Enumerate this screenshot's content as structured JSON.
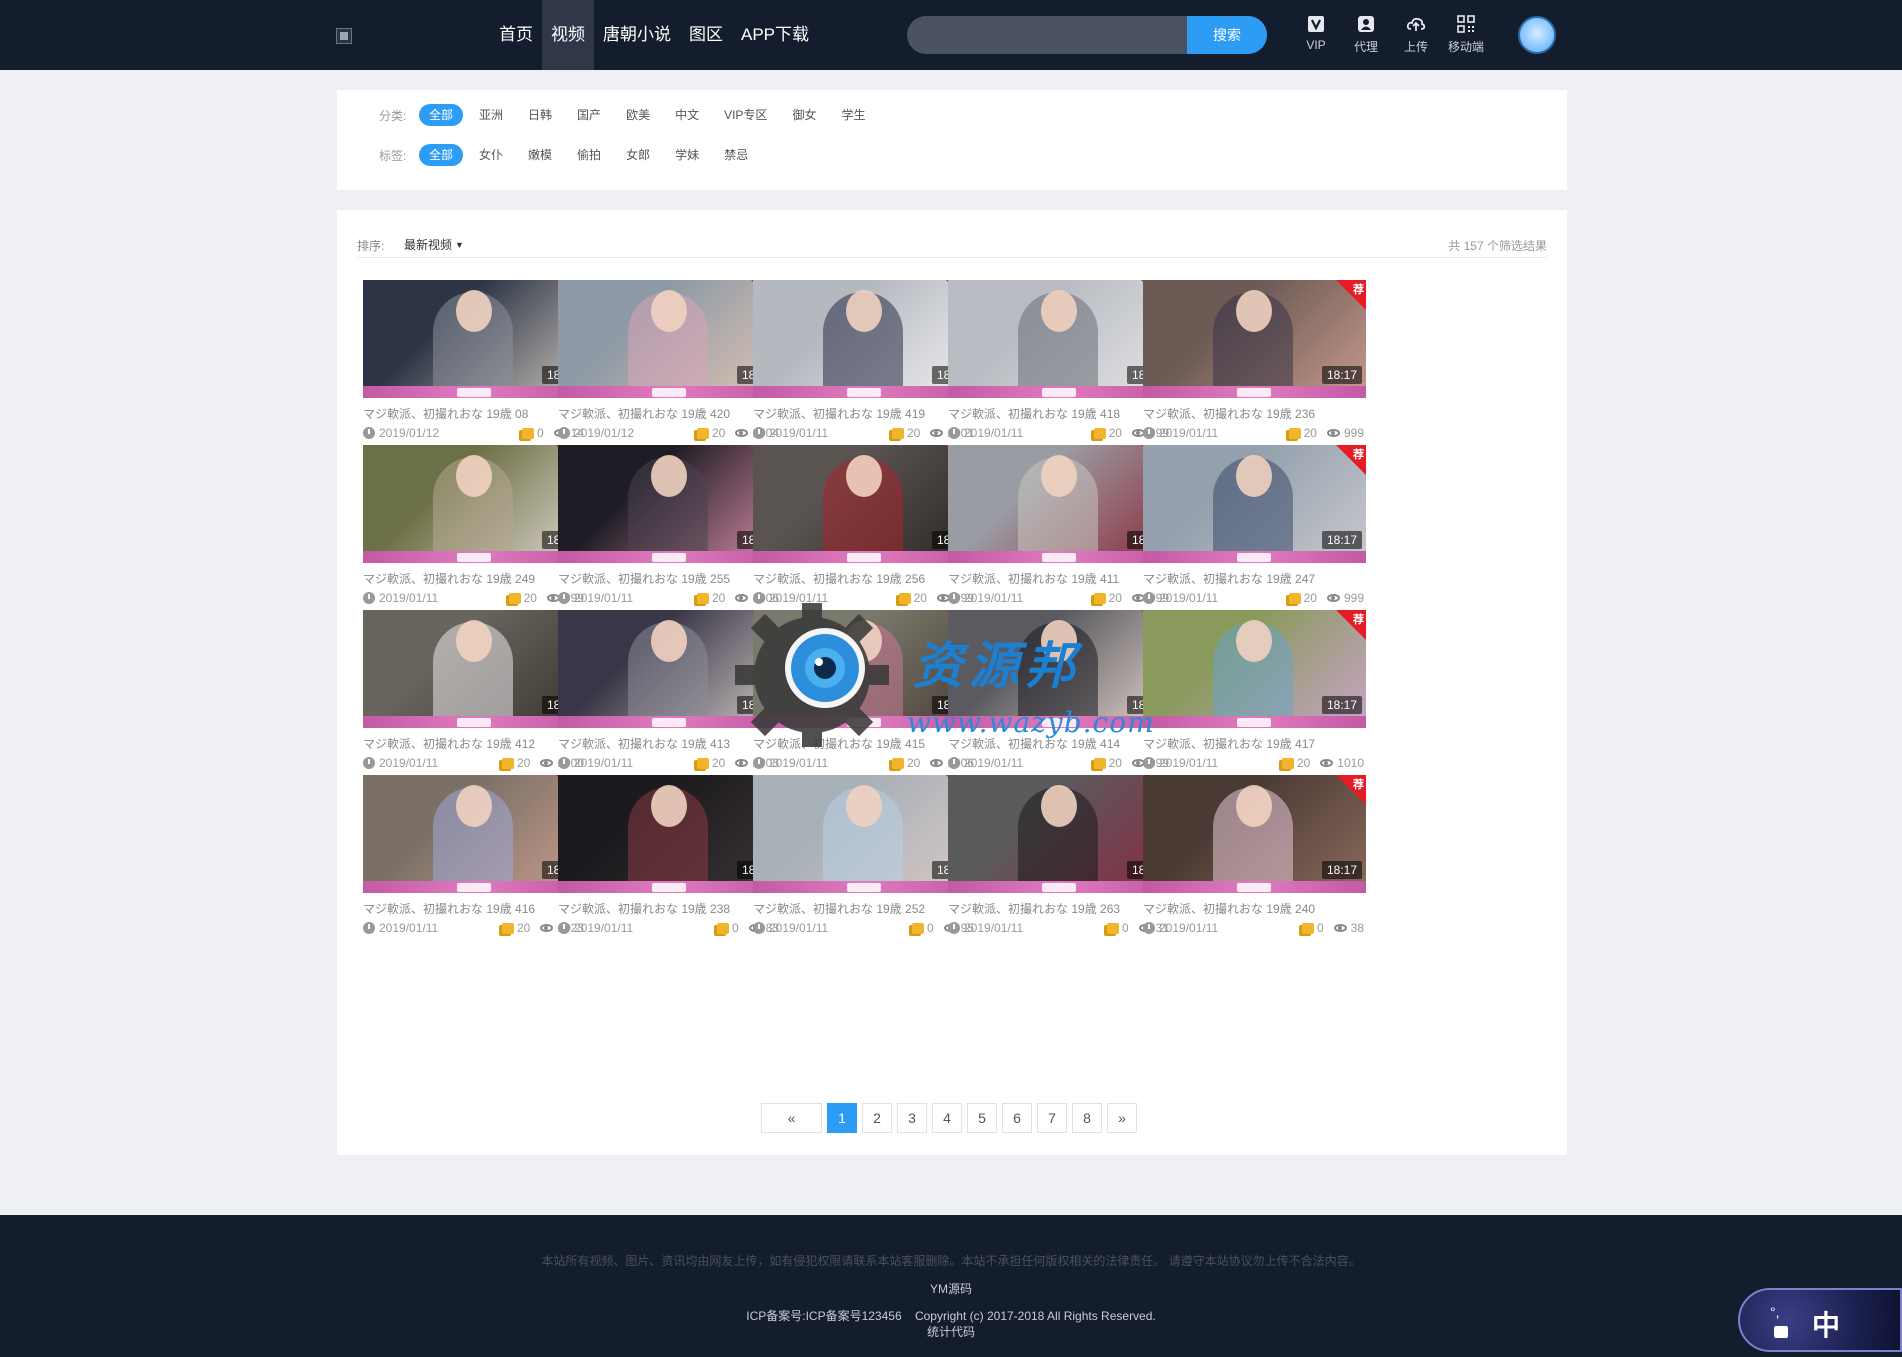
{
  "header": {
    "nav": [
      "首页",
      "视频",
      "唐朝小说",
      "图区",
      "APP下载"
    ],
    "active_nav": 1,
    "search_placeholder": "",
    "search_button": "搜索",
    "tools": [
      {
        "label": "VIP",
        "icon": "vip-icon"
      },
      {
        "label": "代理",
        "icon": "agent-icon"
      },
      {
        "label": "上传",
        "icon": "upload-cloud-icon"
      },
      {
        "label": "移动端",
        "icon": "qrcode-icon"
      }
    ]
  },
  "filters": {
    "category_label": "分类:",
    "categories": [
      "全部",
      "亚洲",
      "日韩",
      "国产",
      "欧美",
      "中文",
      "VIP专区",
      "御女",
      "学生"
    ],
    "tag_label": "标签:",
    "tags": [
      "全部",
      "女仆",
      "嫩模",
      "偷拍",
      "女郎",
      "学妹",
      "禁忌"
    ]
  },
  "sort": {
    "label": "排序:",
    "value": "最新视频",
    "result_text": "共 157 个筛选结果"
  },
  "badge_text": "荐",
  "videos": [
    {
      "title": "マジ軟派、初撮れおな 19歳 08",
      "date": "2019/01/12",
      "coins": "0",
      "views": "14",
      "duration": "18:17",
      "colors": [
        "#2c3446",
        "#8d8f9a",
        "#c8c0b8"
      ]
    },
    {
      "title": "マジ軟派、初撮れおな 19歳 420",
      "date": "2019/01/12",
      "coins": "20",
      "views": "1004",
      "duration": "18:17",
      "colors": [
        "#8e9aa6",
        "#d8a4b8",
        "#e0c4b4"
      ]
    },
    {
      "title": "マジ軟派、初撮れおな 19歳 419",
      "date": "2019/01/11",
      "coins": "20",
      "views": "1001",
      "duration": "18:17",
      "colors": [
        "#b4b8bf",
        "#2a2e48",
        "#f0f0f0"
      ]
    },
    {
      "title": "マジ軟派、初撮れおな 19歳 418",
      "date": "2019/01/11",
      "coins": "20",
      "views": "999",
      "duration": "18:17",
      "colors": [
        "#b8bcc2",
        "#6a6e78",
        "#e4e4e4"
      ]
    },
    {
      "title": "マジ軟派、初撮れおな 19歳 236",
      "date": "2019/01/11",
      "coins": "20",
      "views": "999",
      "duration": "18:17",
      "colors": [
        "#6c5a54",
        "#3a3448",
        "#c79a8c"
      ]
    },
    {
      "title": "マジ軟派、初撮れおな 19歳 249",
      "date": "2019/01/11",
      "coins": "20",
      "views": "999",
      "duration": "18:17",
      "colors": [
        "#6c7046",
        "#b4a890",
        "#e0d8d0"
      ]
    },
    {
      "title": "マジ軟派、初撮れおな 19歳 255",
      "date": "2019/01/11",
      "coins": "20",
      "views": "1006",
      "duration": "18:17",
      "colors": [
        "#1e1c24",
        "#4a444e",
        "#d88ca8"
      ]
    },
    {
      "title": "マジ軟派、初撮れおな 19歳 256",
      "date": "2019/01/11",
      "coins": "20",
      "views": "999",
      "duration": "18:17",
      "colors": [
        "#5a5450",
        "#a8242c",
        "#2a2424"
      ]
    },
    {
      "title": "マジ軟派、初撮れおな 19歳 411",
      "date": "2019/01/11",
      "coins": "20",
      "views": "999",
      "duration": "18:17",
      "colors": [
        "#9a9ca4",
        "#c8c4c0",
        "#8c2a38"
      ]
    },
    {
      "title": "マジ軟派、初撮れおな 19歳 247",
      "date": "2019/01/11",
      "coins": "20",
      "views": "999",
      "duration": "18:17",
      "colors": [
        "#94a0ae",
        "#3a4a6a",
        "#c8c8cc"
      ]
    },
    {
      "title": "マジ軟派、初撮れおな 19歳 412",
      "date": "2019/01/11",
      "coins": "20",
      "views": "1000",
      "duration": "18:17",
      "colors": [
        "#6a645e",
        "#e8e8ea",
        "#3a3430"
      ]
    },
    {
      "title": "マジ軟派、初撮れおな 19歳 413",
      "date": "2019/01/11",
      "coins": "20",
      "views": "1003",
      "duration": "18:17",
      "colors": [
        "#3a3648",
        "#8a8c98",
        "#d0c8c4"
      ]
    },
    {
      "title": "マジ軟派、初撮れおな 19歳 415",
      "date": "2019/01/11",
      "coins": "20",
      "views": "1006",
      "duration": "18:17",
      "colors": [
        "#7a7a6c",
        "#c87898",
        "#4a3e38"
      ]
    },
    {
      "title": "マジ軟派、初撮れおな 19歳 414",
      "date": "2019/01/11",
      "coins": "20",
      "views": "999",
      "duration": "18:17",
      "colors": [
        "#5a5a60",
        "#1c1c22",
        "#e4d4cc"
      ]
    },
    {
      "title": "マジ軟派、初撮れおな 19歳 417",
      "date": "2019/01/11",
      "coins": "20",
      "views": "1010",
      "duration": "18:17",
      "colors": [
        "#8a9a5c",
        "#6aa4c8",
        "#c8a4c8"
      ]
    },
    {
      "title": "マジ軟派、初撮れおな 19歳 416",
      "date": "2019/01/11",
      "coins": "20",
      "views": "1023",
      "duration": "18:17",
      "colors": [
        "#7a7066",
        "#a0a8d8",
        "#c89c8c"
      ]
    },
    {
      "title": "マジ軟派、初撮れおな 19歳 238",
      "date": "2019/01/11",
      "coins": "0",
      "views": "83",
      "duration": "18:17",
      "colors": [
        "#1c1a1e",
        "#8a3a44",
        "#3a3436"
      ]
    },
    {
      "title": "マジ軟派、初撮れおな 19歳 252",
      "date": "2019/01/11",
      "coins": "0",
      "views": "95",
      "duration": "18:17",
      "colors": [
        "#a8b0b8",
        "#b8d0e4",
        "#d8c8c4"
      ]
    },
    {
      "title": "マジ軟派、初撮れおな 19歳 263",
      "date": "2019/01/11",
      "coins": "0",
      "views": "31",
      "duration": "18:17",
      "colors": [
        "#5a5a5c",
        "#1a1a1c",
        "#8a2a44"
      ]
    },
    {
      "title": "マジ軟派、初撮れおな 19歳 240",
      "date": "2019/01/11",
      "coins": "0",
      "views": "38",
      "duration": "18:17",
      "colors": [
        "#4a3a34",
        "#e8c8d8",
        "#8a6a5c"
      ]
    }
  ],
  "pagination": {
    "prev": "«",
    "pages": [
      "1",
      "2",
      "3",
      "4",
      "5",
      "6",
      "7",
      "8"
    ],
    "current": 1,
    "next": "»"
  },
  "watermark": {
    "text": "资源邦",
    "url": "www.wazyb.com"
  },
  "footer": {
    "notice": "本站所有视频、图片、资讯均由网友上传，如有侵犯权限请联系本站客服删除。本站不承担任何版权相关的法律责任。 请遵守本站协议勿上传不合法内容。",
    "brand": "YM源码",
    "copyright": "ICP备案号:ICP备案号123456    Copyright (c) 2017-2018 All Rights Reserved.",
    "stats": "统计代码"
  },
  "lang_switch": {
    "label": "中",
    "degree": "°,"
  },
  "colors": {
    "header_bg": "#141d2d",
    "accent": "#2d9cf5",
    "badge": "#e51c23"
  }
}
